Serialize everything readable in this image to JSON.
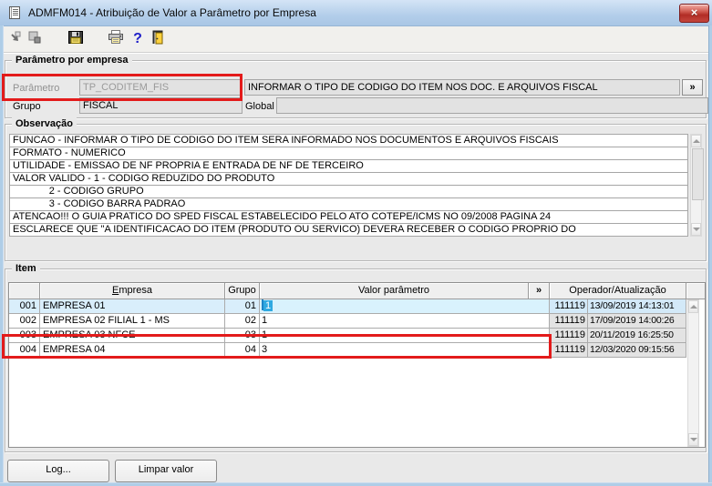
{
  "window": {
    "title": "ADMFM014 - Atribuição de Valor a Parâmetro por Empresa"
  },
  "glyphs": {
    "close": "×",
    "expand": "»",
    "help": "?"
  },
  "toolbar": {
    "icon_names": [
      "transfer",
      "cascade-windows",
      "save",
      "print",
      "help",
      "exit"
    ]
  },
  "param_section": {
    "title": "Parâmetro por empresa",
    "parametro_label": "Parâmetro",
    "parametro_value": "TP_CODITEM_FIS",
    "grupo_label": "Grupo",
    "grupo_value": "FISCAL",
    "descricao_value": "INFORMAR O TIPO DE CODIGO DO ITEM NOS DOC. E ARQUIVOS FISCAL",
    "global_label": "Global",
    "global_value": ""
  },
  "observacao": {
    "title": "Observação",
    "lines": [
      "FUNCAO - INFORMAR O TIPO DE CODIGO DO ITEM SERA INFORMADO NOS DOCUMENTOS E ARQUIVOS FISCAIS",
      "FORMATO - NUMERICO",
      "UTILIDADE - EMISSAO DE NF PROPRIA E ENTRADA DE NF DE TERCEIRO",
      "VALOR VALIDO - 1 - CODIGO REDUZIDO DO PRODUTO",
      "             2 - CODIGO GRUPO",
      "             3 - CODIGO BARRA PADRAO",
      "ATENCAO!!! O GUIA PRATICO DO SPED FISCAL ESTABELECIDO PELO ATO COTEPE/ICMS NO 09/2008 PAGINA 24",
      "ESCLARECE QUE \"A IDENTIFICACAO DO ITEM (PRODUTO OU SERVICO) DEVERA RECEBER O CODIGO PROPRIO DO"
    ]
  },
  "item": {
    "title": "Item",
    "columns": {
      "empresa_hotkey": "E",
      "empresa_rest": "mpresa",
      "grupo": "Grupo",
      "valor": "Valor parâmetro",
      "expand": "»",
      "operador": "Operador/Atualização"
    },
    "rows": [
      {
        "num": "001",
        "empresa": "EMPRESA 01",
        "grupo": "01",
        "valor": "1",
        "operador": "111119",
        "atualizacao": "13/09/2019 14:13:01"
      },
      {
        "num": "002",
        "empresa": "EMPRESA 02 FILIAL 1 - MS",
        "grupo": "02",
        "valor": "1",
        "operador": "111119",
        "atualizacao": "17/09/2019 14:00:26"
      },
      {
        "num": "003",
        "empresa": "EMPRESA 03 NFCE",
        "grupo": "03",
        "valor": "1",
        "operador": "111119",
        "atualizacao": "20/11/2019 16:25:50"
      },
      {
        "num": "004",
        "empresa": "EMPRESA 04",
        "grupo": "04",
        "valor": "3",
        "operador": "111119",
        "atualizacao": "12/03/2020 09:15:56"
      }
    ]
  },
  "footer": {
    "log_label": "Log...",
    "limpar_label": "Limpar valor"
  },
  "colors": {
    "annotation_red": "#e31b1b",
    "row_highlight": "#d9eefb",
    "cell_selection": "#2fa9e1",
    "titlebar_blue": "#b3ceea"
  }
}
